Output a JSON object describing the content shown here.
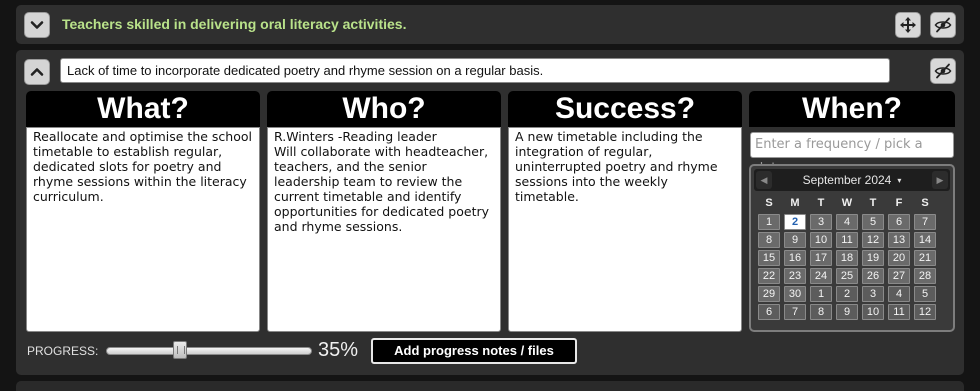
{
  "top_section": {
    "title": "Teachers skilled in delivering oral literacy activities.",
    "collapse_icon": "chevron-down-icon",
    "move_icon": "move-arrows-icon",
    "hide_icon": "eye-slash-icon",
    "title_color": "#b9e28a"
  },
  "main_section": {
    "expand_icon": "chevron-up-icon",
    "hide_icon": "eye-slash-icon",
    "issue_text": "Lack of time to incorporate dedicated poetry and rhyme session on a regular basis."
  },
  "columns": [
    {
      "heading": "What?",
      "text": "Reallocate and optimise the school timetable to establish regular, dedicated slots for poetry and rhyme sessions within the literacy curriculum."
    },
    {
      "heading": "Who?",
      "text": "R.Winters -Reading leader\nWill collaborate with headteacher, teachers, and the senior leadership team to review the current timetable and identify opportunities for dedicated poetry and rhyme sessions."
    },
    {
      "heading": "Success?",
      "text": "A new timetable including the integration of regular, uninterrupted poetry and rhyme sessions into the weekly timetable."
    }
  ],
  "when": {
    "heading": "When?",
    "frequency_placeholder": "Enter a frequency / pick a date:",
    "calendar": {
      "month_label": "September 2024",
      "caret": "▾",
      "prev": "◀",
      "next": "▶",
      "weekdays": [
        "S",
        "M",
        "T",
        "W",
        "T",
        "F",
        "S"
      ],
      "today": "2",
      "weeks": [
        [
          "1",
          "2",
          "3",
          "4",
          "5",
          "6",
          "7"
        ],
        [
          "8",
          "9",
          "10",
          "11",
          "12",
          "13",
          "14"
        ],
        [
          "15",
          "16",
          "17",
          "18",
          "19",
          "20",
          "21"
        ],
        [
          "22",
          "23",
          "24",
          "25",
          "26",
          "27",
          "28"
        ],
        [
          "29",
          "30",
          "1",
          "2",
          "3",
          "4",
          "5"
        ],
        [
          "6",
          "7",
          "8",
          "9",
          "10",
          "11",
          "12"
        ]
      ]
    }
  },
  "progress": {
    "label": "PROGRESS:",
    "value_text": "35%",
    "value": 0.35,
    "notes_button": "Add progress notes / files"
  }
}
